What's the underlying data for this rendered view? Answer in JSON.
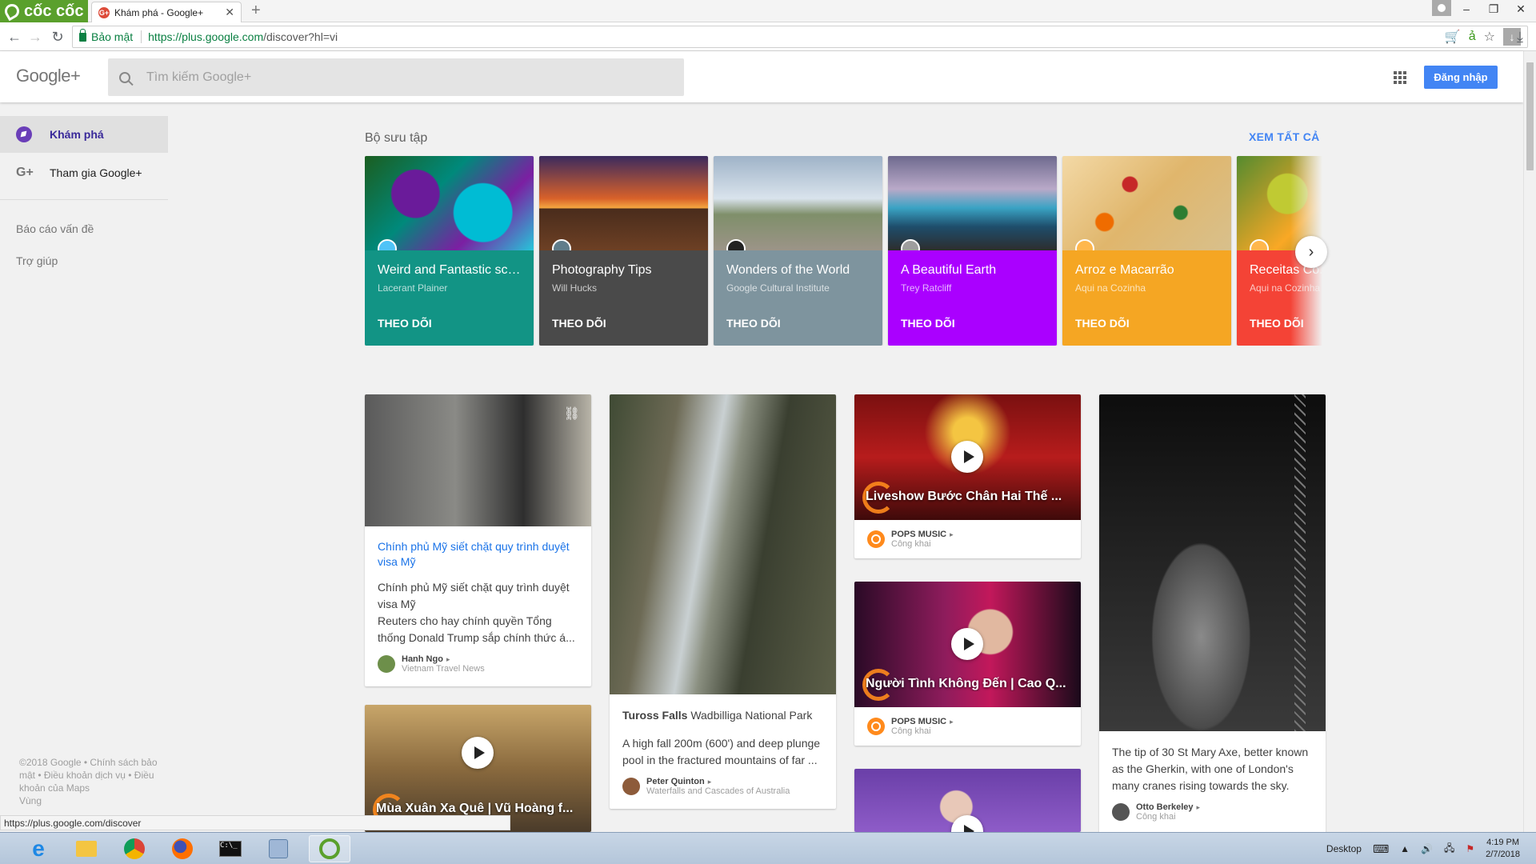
{
  "browser": {
    "brand": "cốc cốc",
    "tab_title": "Khám phá - Google+",
    "secure_label": "Bảo mật",
    "url_domain": "https://plus.google.com",
    "url_path": "/discover?hl=vi"
  },
  "header": {
    "logo": "Google+",
    "search_placeholder": "Tìm kiếm Google+",
    "signin_label": "Đăng nhập"
  },
  "sidebar": {
    "items": [
      {
        "label": "Khám phá",
        "icon": "compass-icon"
      },
      {
        "label": "Tham gia Google+",
        "icon": "gplus-icon"
      }
    ],
    "links": [
      "Báo cáo vấn đề",
      "Trợ giúp"
    ],
    "footer": "©2018 Google • Chính sách bảo mật • Điều khoản dịch vụ • Điều khoản của Maps",
    "footer_extra": "Vùng"
  },
  "collections": {
    "title": "Bộ sưu tập",
    "see_all": "XEM TẤT CẢ",
    "items": [
      {
        "title": "Weird and Fantastic sci...",
        "owner": "Lacerant Plainer",
        "follow": "THEO DÕI",
        "color": "#129485"
      },
      {
        "title": "Photography Tips",
        "owner": "Will Hucks",
        "follow": "THEO DÕI",
        "color": "#4a4a4a"
      },
      {
        "title": "Wonders of the World",
        "owner": "Google Cultural Institute",
        "follow": "THEO DÕI",
        "color": "#7e949e"
      },
      {
        "title": "A Beautiful Earth",
        "owner": "Trey Ratcliff",
        "follow": "THEO DÕI",
        "color": "#aa00ff"
      },
      {
        "title": "Arroz e Macarrão",
        "owner": "Aqui na Cozinha",
        "follow": "THEO DÕI",
        "color": "#f5a623"
      },
      {
        "title": "Receitas Co...",
        "owner": "Aqui na Cozinha",
        "follow": "THEO DÕI",
        "color": "#f44336"
      }
    ]
  },
  "posts": {
    "visa": {
      "link_title": "Chính phủ Mỹ siết chặt quy trình duyệt visa Mỹ",
      "text1": "Chính phủ Mỹ siết chặt quy trình duyệt visa Mỹ",
      "text2": "Reuters cho hay chính quyền Tổng thống Donald Trump sắp chính thức á...",
      "author": "Hanh Ngo",
      "sub": "Vietnam Travel News"
    },
    "music3": {
      "title": "Mùa Xuân Xa Quê | Vũ Hoàng f..."
    },
    "falls": {
      "title_bold": "Tuross Falls",
      "title_rest": "Wadbilliga National Park",
      "text": "A high fall 200m (600') and deep plunge pool in the fractured mountains of far ...",
      "author": "Peter Quinton",
      "sub": "Waterfalls and Cascades of Australia"
    },
    "video1": {
      "title": "Liveshow Bước Chân Hai Thế ...",
      "author": "POPS MUSIC",
      "sub": "Công khai"
    },
    "video2": {
      "title": "Người Tình Không Đến | Cao Q...",
      "author": "POPS MUSIC",
      "sub": "Công khai"
    },
    "gherkin": {
      "text": "The tip of 30 St Mary Axe, better known as the Gherkin, with one of London's many cranes rising towards the sky.",
      "author": "Otto Berkeley",
      "sub": "Công khai"
    }
  },
  "status_url": "https://plus.google.com/discover",
  "taskbar": {
    "desktop_label": "Desktop",
    "time": "4:19 PM",
    "date": "2/7/2018"
  }
}
